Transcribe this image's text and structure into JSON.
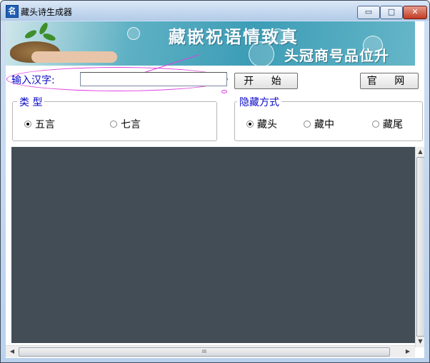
{
  "window": {
    "title": "藏头诗生成器",
    "app_icon_glyph": "名",
    "controls": {
      "minimize": "▭",
      "maximize": "□",
      "close": "✕"
    }
  },
  "banner": {
    "line1": "藏嵌祝语情致真",
    "line2": "头冠商号品位升"
  },
  "input": {
    "label": "输入汉字:",
    "value": ""
  },
  "buttons": {
    "start": "开 始",
    "website": "官 网"
  },
  "type_group": {
    "title": "类  型",
    "options": [
      {
        "label": "五言",
        "selected": true
      },
      {
        "label": "七言",
        "selected": false
      }
    ]
  },
  "hide_group": {
    "title": "隐藏方式",
    "options": [
      {
        "label": "藏头",
        "selected": true
      },
      {
        "label": "藏中",
        "selected": false
      },
      {
        "label": "藏尾",
        "selected": false
      }
    ]
  },
  "scrollbars": {
    "up": "▲",
    "down": "▼",
    "left": "◀",
    "right": "▶",
    "grip": "III"
  },
  "colors": {
    "label_blue": "#0a0ac8",
    "annotation_magenta": "#e040e0",
    "output_bg": "#424d55",
    "close_red": "#c23b22"
  }
}
